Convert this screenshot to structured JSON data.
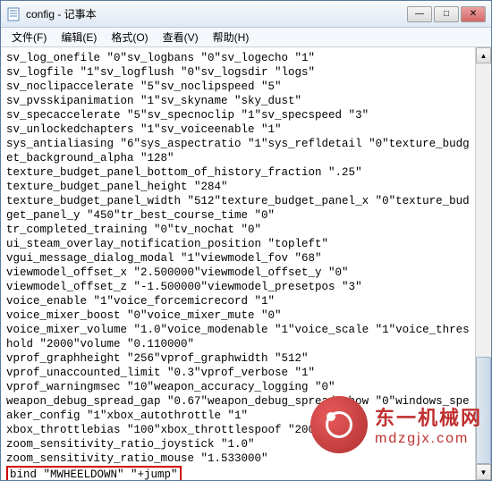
{
  "window": {
    "title": "config - 记事本"
  },
  "menu": {
    "file": "文件(F)",
    "edit": "编辑(E)",
    "format": "格式(O)",
    "view": "查看(V)",
    "help": "帮助(H)"
  },
  "win_controls": {
    "min": "—",
    "max": "□",
    "close": "✕"
  },
  "content_lines": "sv_log_onefile \"0\"sv_logbans \"0\"sv_logecho \"1\"\nsv_logfile \"1\"sv_logflush \"0\"sv_logsdir \"logs\"\nsv_noclipaccelerate \"5\"sv_noclipspeed \"5\"\nsv_pvsskipanimation \"1\"sv_skyname \"sky_dust\"\nsv_specaccelerate \"5\"sv_specnoclip \"1\"sv_specspeed \"3\"\nsv_unlockedchapters \"1\"sv_voiceenable \"1\"\nsys_antialiasing \"6\"sys_aspectratio \"1\"sys_refldetail \"0\"texture_budget_background_alpha \"128\"\ntexture_budget_panel_bottom_of_history_fraction \".25\"\ntexture_budget_panel_height \"284\"\ntexture_budget_panel_width \"512\"texture_budget_panel_x \"0\"texture_budget_panel_y \"450\"tr_best_course_time \"0\"\ntr_completed_training \"0\"tv_nochat \"0\"\nui_steam_overlay_notification_position \"topleft\"\nvgui_message_dialog_modal \"1\"viewmodel_fov \"68\"\nviewmodel_offset_x \"2.500000\"viewmodel_offset_y \"0\"\nviewmodel_offset_z \"-1.500000\"viewmodel_presetpos \"3\"\nvoice_enable \"1\"voice_forcemicrecord \"1\"\nvoice_mixer_boost \"0\"voice_mixer_mute \"0\"\nvoice_mixer_volume \"1.0\"voice_modenable \"1\"voice_scale \"1\"voice_threshold \"2000\"volume \"0.110000\"\nvprof_graphheight \"256\"vprof_graphwidth \"512\"\nvprof_unaccounted_limit \"0.3\"vprof_verbose \"1\"\nvprof_warningmsec \"10\"weapon_accuracy_logging \"0\"\nweapon_debug_spread_gap \"0.67\"weapon_debug_spread_show \"0\"windows_speaker_config \"1\"xbox_autothrottle \"1\"\nxbox_throttlebias \"100\"xbox_throttlespoof \"200\"\nzoom_sensitivity_ratio_joystick \"1.0\"\nzoom_sensitivity_ratio_mouse \"1.533000\"",
  "highlighted_line": "bind \"MWHEELDOWN\" \"+jump\"",
  "scrollbar": {
    "up_arrow": "▲",
    "down_arrow": "▼"
  },
  "watermark": {
    "cn_text": "东一机械网",
    "url": "mdzgjx.com"
  }
}
